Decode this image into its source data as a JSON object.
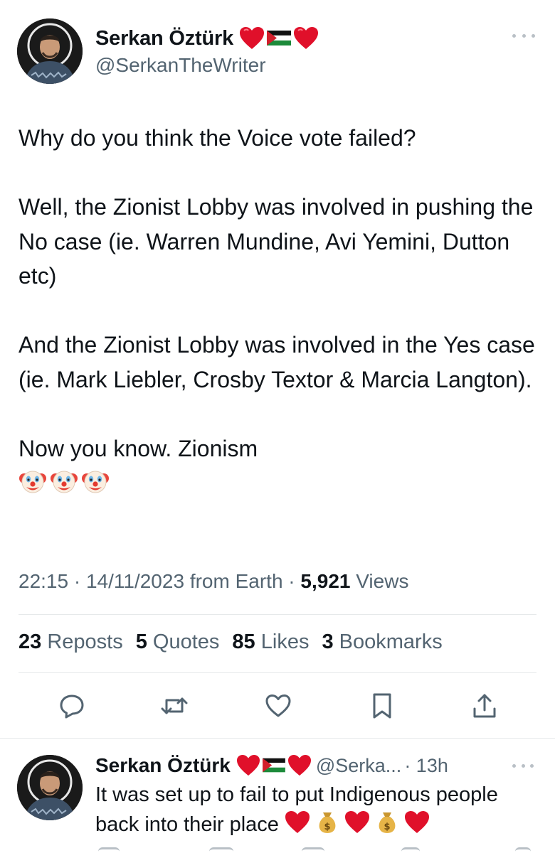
{
  "tweet": {
    "author": {
      "display_name": "Serkan Öztürk",
      "handle": "@SerkanTheWriter",
      "badges": [
        "red-heart-icon",
        "palestine-flag-icon",
        "red-heart-icon"
      ]
    },
    "text": {
      "p1": "Why do you think the Voice vote failed?",
      "p2": "Well, the Zionist Lobby was involved in pushing the No case (ie. Warren Mundine, Avi Yemini, Dutton etc)",
      "p3": "And the Zionist Lobby was involved in the Yes case (ie. Mark Liebler, Crosby Textor & Marcia Langton).",
      "p4": "Now you know. Zionism",
      "emojis": [
        "clown-face-icon",
        "clown-face-icon",
        "clown-face-icon"
      ]
    },
    "meta": {
      "time": "22:15",
      "separator": "·",
      "date": "14/11/2023",
      "source": "from Earth",
      "views_count": "5,921",
      "views_label": "Views"
    },
    "stats": {
      "reposts_count": "23",
      "reposts_label": "Reposts",
      "quotes_count": "5",
      "quotes_label": "Quotes",
      "likes_count": "85",
      "likes_label": "Likes",
      "bookmarks_count": "3",
      "bookmarks_label": "Bookmarks"
    },
    "actions": [
      "reply-icon",
      "repost-icon",
      "like-icon",
      "bookmark-icon",
      "share-icon"
    ]
  },
  "reply": {
    "display_name": "Serkan Öztürk",
    "handle": "@Serka...",
    "time": "· 13h",
    "text": "It was set up to fail to put Indigenous people back into their place",
    "emojis": [
      "red-heart-icon",
      "money-bag-icon",
      "red-heart-icon",
      "money-bag-icon",
      "red-heart-icon"
    ]
  },
  "colors": {
    "text_primary": "#0f1419",
    "text_secondary": "#536471",
    "divider": "#e6e9ea",
    "heart": "#e0102a"
  }
}
